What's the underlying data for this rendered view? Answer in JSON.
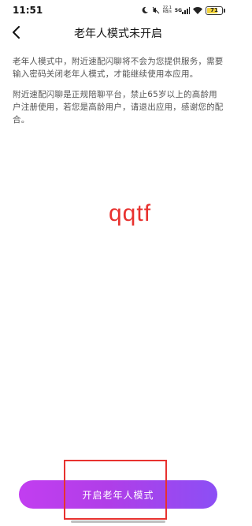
{
  "status_bar": {
    "time": "11:51",
    "net_speed_value": "22.1",
    "net_speed_unit": "KB/s",
    "network_type": "5G",
    "battery_level": "71",
    "icons": [
      "moon-icon",
      "mute-icon",
      "signal-icon",
      "wifi-icon",
      "battery-icon"
    ]
  },
  "header": {
    "title": "老年人模式未开启",
    "back_icon": "chevron-left-icon"
  },
  "content": {
    "paragraph_1": "老年人模式中，附近速配闪聊将不会为您提供服务，需要输入密码关闭老年人模式，才能继续使用本应用。",
    "paragraph_2": "附近速配闪聊是正规陪聊平台，禁止65岁以上的高龄用户注册使用，若您是高龄用户，请退出应用，感谢您的配合。"
  },
  "watermark_text": "qqtf",
  "cta": {
    "label": "开启老年人模式"
  },
  "colors": {
    "accent_gradient_start": "#c23ef0",
    "accent_gradient_end": "#8c4ff5",
    "highlight_red": "#e8322f"
  }
}
